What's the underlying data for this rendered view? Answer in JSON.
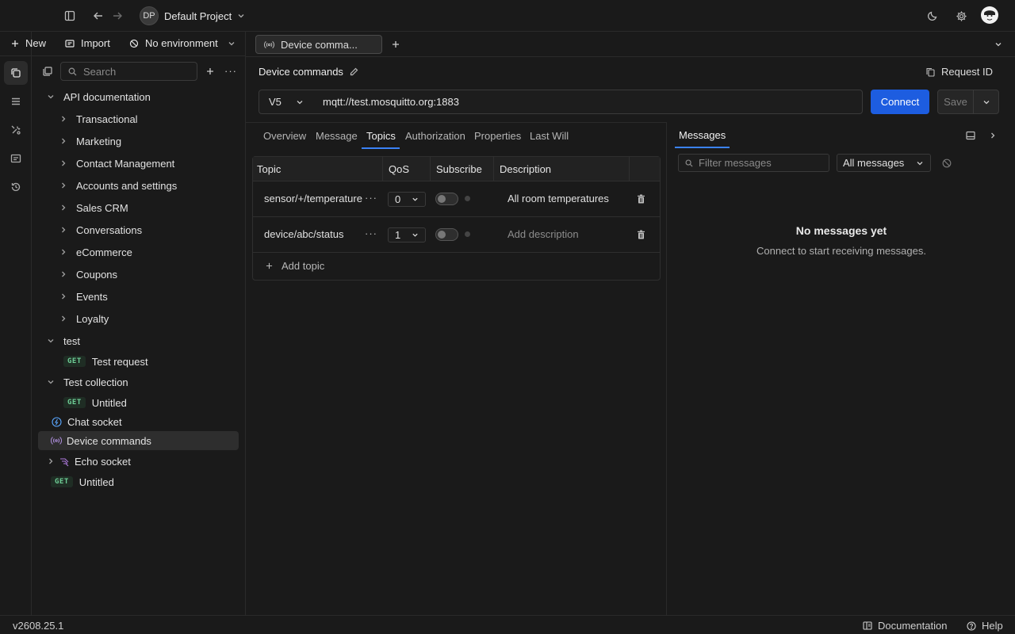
{
  "topbar": {
    "project_initials": "DP",
    "project_name": "Default Project"
  },
  "sidebar_toolbar": {
    "new_label": "New",
    "import_label": "Import",
    "environment_label": "No environment"
  },
  "sidebar": {
    "search_placeholder": "Search",
    "api_doc": {
      "label": "API documentation",
      "children": [
        "Transactional",
        "Marketing",
        "Contact Management",
        "Accounts and settings",
        "Sales CRM",
        "Conversations",
        "eCommerce",
        "Coupons",
        "Events",
        "Loyalty"
      ]
    },
    "test": {
      "label": "test",
      "method": "GET",
      "child": "Test request"
    },
    "test_collection": {
      "label": "Test collection",
      "method": "GET",
      "child": "Untitled"
    },
    "chat_socket": "Chat socket",
    "device_commands": "Device commands",
    "echo_socket": "Echo socket",
    "untitled": {
      "method": "GET",
      "label": "Untitled"
    }
  },
  "tabs": {
    "active_tab": "Device comma..."
  },
  "request": {
    "name": "Device commands",
    "request_id_label": "Request ID",
    "version": "V5",
    "url": "mqtt://test.mosquitto.org:1883",
    "connect_label": "Connect",
    "save_label": "Save"
  },
  "request_tabs": [
    "Overview",
    "Message",
    "Topics",
    "Authorization",
    "Properties",
    "Last Will"
  ],
  "active_request_tab": "Topics",
  "topics": {
    "headers": {
      "topic": "Topic",
      "qos": "QoS",
      "subscribe": "Subscribe",
      "description": "Description"
    },
    "rows": [
      {
        "topic": "sensor/+/temperature",
        "qos": "0",
        "description": "All room temperatures",
        "subscribed": false
      },
      {
        "topic": "device/abc/status",
        "qos": "1",
        "description": "",
        "description_placeholder": "Add description",
        "subscribed": false
      }
    ],
    "add_label": "Add topic"
  },
  "messages": {
    "tab_label": "Messages",
    "filter_placeholder": "Filter messages",
    "filter_select": "All messages",
    "empty_title": "No messages yet",
    "empty_subtitle": "Connect to start receiving messages."
  },
  "footer": {
    "version": "v2608.25.1",
    "documentation_label": "Documentation",
    "help_label": "Help"
  },
  "colors": {
    "accent": "#1d5de0",
    "tab_underline": "#3b82f6",
    "get_method": "#6fcf97",
    "background": "#1a1a1a"
  }
}
